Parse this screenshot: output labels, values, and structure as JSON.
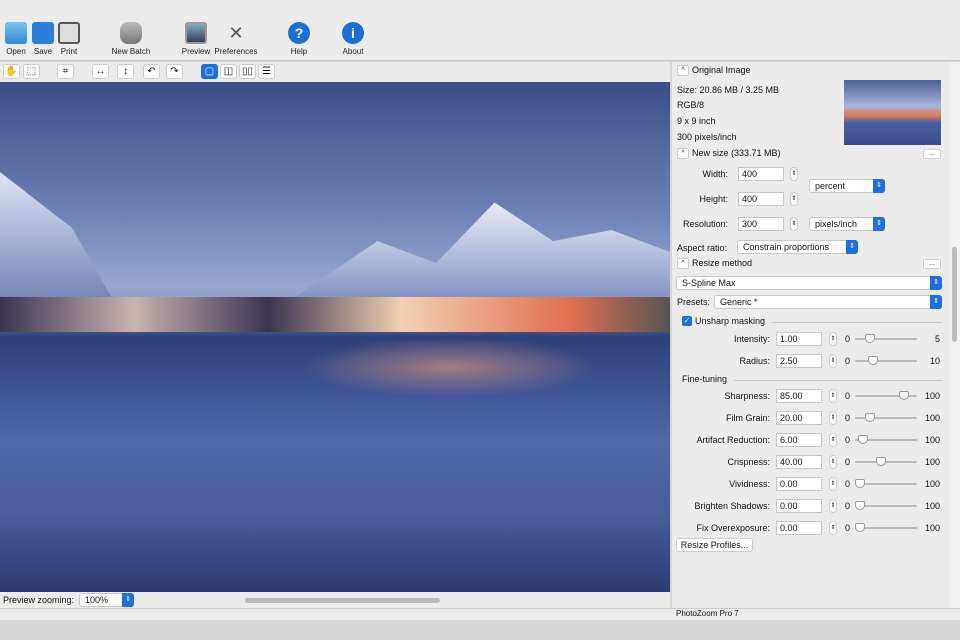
{
  "toolbar": {
    "open": "Open",
    "save": "Save",
    "print": "Print",
    "new_batch": "New Batch",
    "preview": "Preview",
    "preferences": "Preferences",
    "help": "Help",
    "about": "About"
  },
  "original": {
    "title": "Original Image",
    "size": "Size: 20.86 MB / 3.25 MB",
    "mode": "RGB/8",
    "dims": "9 x 9 inch",
    "res": "300 pixels/inch"
  },
  "newsize": {
    "title": "New size (333.71 MB)",
    "width_label": "Width:",
    "width": "400",
    "height_label": "Height:",
    "height": "400",
    "unit": "percent",
    "resolution_label": "Resolution:",
    "resolution": "300",
    "res_unit": "pixels/inch",
    "aspect_label": "Aspect ratio:",
    "aspect": "Constrain proportions",
    "more": "..."
  },
  "resize": {
    "title": "Resize method",
    "method": "S-Spline Max",
    "presets_label": "Presets:",
    "preset": "Generic *",
    "more": "..."
  },
  "unsharp": {
    "label": "Unsharp masking",
    "checked": true,
    "rows": [
      {
        "label": "Intensity:",
        "value": "1.00",
        "min": "0",
        "max": "5",
        "fraction": 0.2
      },
      {
        "label": "Radius:",
        "value": "2.50",
        "min": "0",
        "max": "10",
        "fraction": 0.25
      }
    ]
  },
  "finetuning": {
    "label": "Fine-tuning",
    "rows": [
      {
        "label": "Sharpness:",
        "value": "85.00",
        "min": "0",
        "max": "100",
        "fraction": 0.85
      },
      {
        "label": "Film Grain:",
        "value": "20.00",
        "min": "0",
        "max": "100",
        "fraction": 0.2
      },
      {
        "label": "Artifact Reduction:",
        "value": "6.00",
        "min": "0",
        "max": "100",
        "fraction": 0.06
      },
      {
        "label": "Crispness:",
        "value": "40.00",
        "min": "0",
        "max": "100",
        "fraction": 0.4
      },
      {
        "label": "Vividness:",
        "value": "0.00",
        "min": "0",
        "max": "100",
        "fraction": 0
      },
      {
        "label": "Brighten Shadows:",
        "value": "0.00",
        "min": "0",
        "max": "100",
        "fraction": 0
      },
      {
        "label": "Fix Overexposure:",
        "value": "0.00",
        "min": "0",
        "max": "100",
        "fraction": 0
      }
    ]
  },
  "profiles_button": "Resize Profiles...",
  "preview_zoom": {
    "label": "Preview zooming:",
    "value": "100%"
  },
  "status": "PhotoZoom Pro 7"
}
